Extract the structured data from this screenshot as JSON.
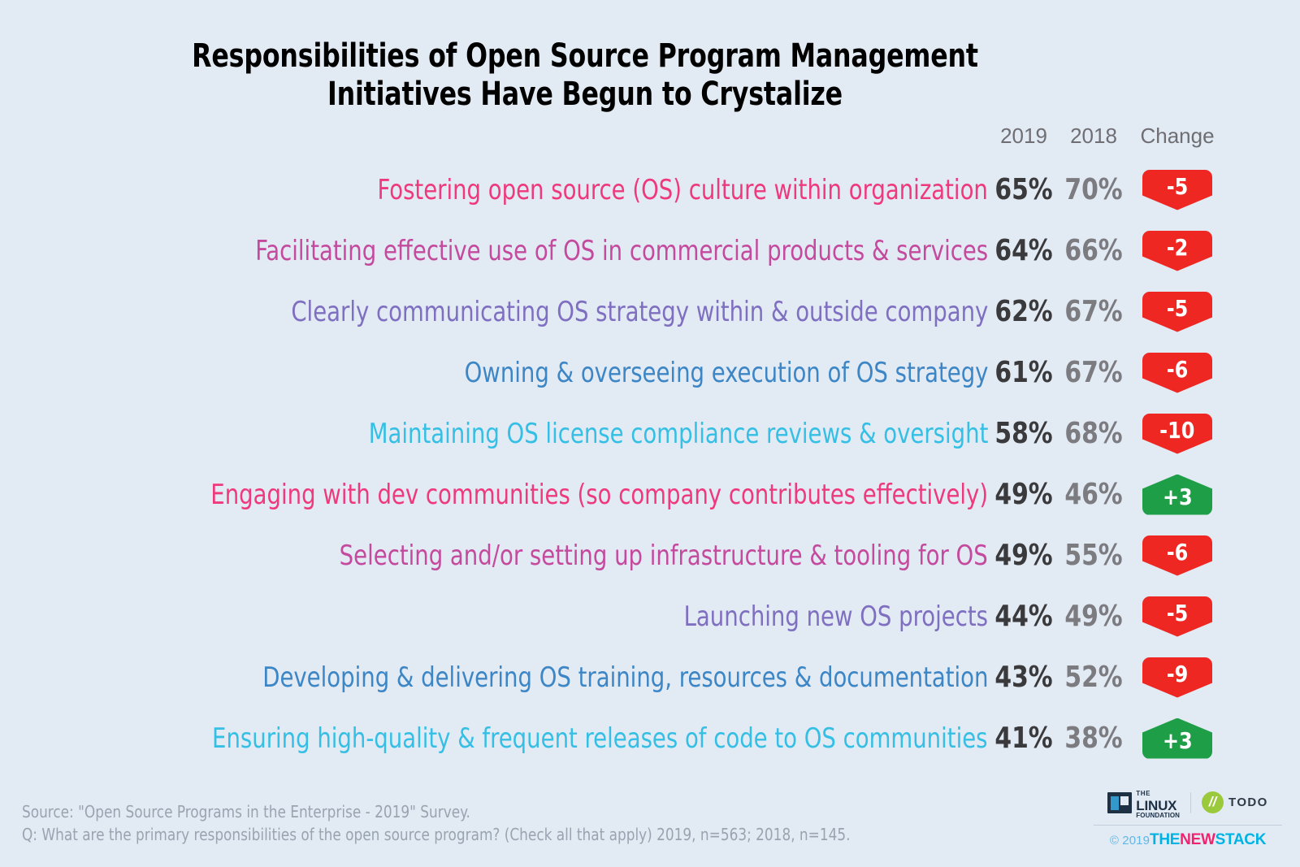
{
  "title": {
    "line1": "Responsibilities of Open Source Program Management",
    "line2": "Initiatives Have Begun to Crystalize"
  },
  "columns": {
    "year_current": "2019",
    "year_previous": "2018",
    "change": "Change"
  },
  "colors": {
    "background": "#e2eaf4",
    "pink": "#ee3a7d",
    "magenta": "#c44a9e",
    "purple": "#7f6fc0",
    "blue": "#3d86c6",
    "cyan": "#35bfe5",
    "value_current": "#3a3a3c",
    "value_previous": "#7b7b80",
    "badge_negative": "#ee2722",
    "badge_positive": "#1d9e47",
    "header_text": "#6e6e73",
    "footer_text": "#9aa3b0"
  },
  "chart_data": {
    "type": "table",
    "title": "Responsibilities of Open Source Program Management Initiatives Have Begun to Crystalize",
    "xlabel": "",
    "ylabel": "",
    "categories": [
      "Fostering open source (OS) culture within organization",
      "Facilitating effective use of OS in commercial products & services",
      "Clearly communicating OS strategy within & outside company",
      "Owning & overseeing execution of OS strategy",
      "Maintaining OS license compliance reviews & oversight",
      "Engaging with dev communities (so company contributes effectively)",
      "Selecting and/or setting up infrastructure & tooling for OS",
      "Launching new OS projects",
      "Developing & delivering OS training, resources & documentation",
      "Ensuring high-quality & frequent releases of code to OS communities"
    ],
    "series": [
      {
        "name": "2019",
        "values": [
          65,
          64,
          62,
          61,
          58,
          49,
          49,
          44,
          43,
          41
        ]
      },
      {
        "name": "2018",
        "values": [
          70,
          66,
          67,
          67,
          68,
          46,
          55,
          49,
          52,
          38
        ]
      },
      {
        "name": "Change",
        "values": [
          -5,
          -2,
          -5,
          -6,
          -10,
          3,
          -6,
          -5,
          -9,
          3
        ]
      }
    ],
    "units": "percent",
    "legend": "none",
    "grid": false
  },
  "rows": [
    {
      "label": "Fostering open source (OS) culture within organization",
      "v2019": "65%",
      "v2018": "70%",
      "change": "-5",
      "direction": "down",
      "color": "#ee3a7d"
    },
    {
      "label": "Facilitating effective use of OS in commercial products & services",
      "v2019": "64%",
      "v2018": "66%",
      "change": "-2",
      "direction": "down",
      "color": "#c44a9e"
    },
    {
      "label": "Clearly communicating OS strategy within & outside company",
      "v2019": "62%",
      "v2018": "67%",
      "change": "-5",
      "direction": "down",
      "color": "#7f6fc0"
    },
    {
      "label": "Owning & overseeing execution of OS strategy",
      "v2019": "61%",
      "v2018": "67%",
      "change": "-6",
      "direction": "down",
      "color": "#3d86c6"
    },
    {
      "label": "Maintaining OS license compliance reviews & oversight",
      "v2019": "58%",
      "v2018": "68%",
      "change": "-10",
      "direction": "down",
      "color": "#35bfe5"
    },
    {
      "label": "Engaging with dev communities (so company contributes effectively)",
      "v2019": "49%",
      "v2018": "46%",
      "change": "+3",
      "direction": "up",
      "color": "#ee3a7d"
    },
    {
      "label": "Selecting and/or setting up infrastructure & tooling for OS",
      "v2019": "49%",
      "v2018": "55%",
      "change": "-6",
      "direction": "down",
      "color": "#c44a9e"
    },
    {
      "label": "Launching new OS projects",
      "v2019": "44%",
      "v2018": "49%",
      "change": "-5",
      "direction": "down",
      "color": "#7f6fc0"
    },
    {
      "label": "Developing & delivering OS training, resources & documentation",
      "v2019": "43%",
      "v2018": "52%",
      "change": "-9",
      "direction": "down",
      "color": "#3d86c6"
    },
    {
      "label": "Ensuring high-quality & frequent releases of code to OS communities",
      "v2019": "41%",
      "v2018": "38%",
      "change": "+3",
      "direction": "up",
      "color": "#35bfe5"
    }
  ],
  "footer": {
    "source_line1": "Source: \"Open Source Programs in the Enterprise - 2019\" Survey.",
    "source_line2": "Q: What are the primary responsibilities of the open source program? (Check all that apply) 2019, n=563; 2018, n=145."
  },
  "brand": {
    "linux_foundation_the": "THE",
    "linux_foundation_name": "LINUX",
    "linux_foundation_sub": "FOUNDATION",
    "todo_mark": "//",
    "todo_name": "TODO",
    "copyright": "© 2019",
    "tns_the": "THE",
    "tns_new": "NEW",
    "tns_stack": "STACK"
  }
}
